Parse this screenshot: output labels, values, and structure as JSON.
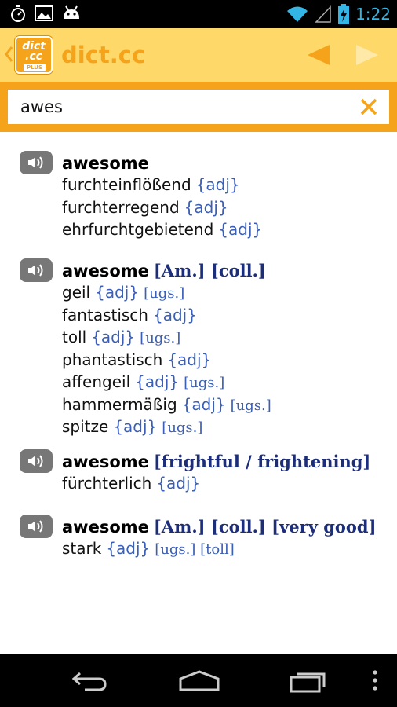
{
  "status_bar": {
    "time": "1:22",
    "icons": [
      "stopwatch-icon",
      "image-icon",
      "android-icon",
      "wifi-icon",
      "signal-icon",
      "battery-charging-icon"
    ]
  },
  "action_bar": {
    "logo_line1": "dict",
    "logo_line2": ".cc",
    "logo_badge": "PLUS",
    "title": "dict.cc",
    "colors": {
      "background": "#ffd86a",
      "accent": "#f5a31a"
    },
    "icons": [
      "back-chevron-icon",
      "prev-arrow-icon",
      "next-arrow-icon"
    ]
  },
  "search": {
    "value": "awes",
    "clear_icon": "close-icon"
  },
  "results": [
    {
      "headword": "awesome",
      "note": "",
      "translations": [
        {
          "text": "furchteinflößend",
          "pos": "{adj}",
          "tag": ""
        },
        {
          "text": "furchterregend",
          "pos": "{adj}",
          "tag": ""
        },
        {
          "text": "ehrfurchtgebietend",
          "pos": "{adj}",
          "tag": ""
        }
      ]
    },
    {
      "headword": "awesome",
      "note": "[Am.] [coll.]",
      "translations": [
        {
          "text": "geil",
          "pos": "{adj}",
          "tag": "[ugs.]"
        },
        {
          "text": "fantastisch",
          "pos": "{adj}",
          "tag": ""
        },
        {
          "text": "toll",
          "pos": "{adj}",
          "tag": "[ugs.]"
        },
        {
          "text": "phantastisch",
          "pos": "{adj}",
          "tag": ""
        },
        {
          "text": "affengeil",
          "pos": "{adj}",
          "tag": "[ugs.]"
        },
        {
          "text": "hammermäßig",
          "pos": "{adj}",
          "tag": "[ugs.]"
        },
        {
          "text": "spitze",
          "pos": "{adj}",
          "tag": "[ugs.]"
        }
      ]
    },
    {
      "headword": "awesome",
      "note": "[frightful / frightening]",
      "translations": [
        {
          "text": "fürchterlich",
          "pos": "{adj}",
          "tag": ""
        }
      ]
    },
    {
      "headword": "awesome",
      "note": "[Am.] [coll.] [very good]",
      "translations": [
        {
          "text": "stark",
          "pos": "{adj}",
          "tag": "[ugs.] [toll]"
        }
      ]
    }
  ],
  "nav_bar": {
    "icons": [
      "nav-back-icon",
      "nav-home-icon",
      "nav-recent-apps-icon",
      "overflow-menu-icon"
    ]
  }
}
